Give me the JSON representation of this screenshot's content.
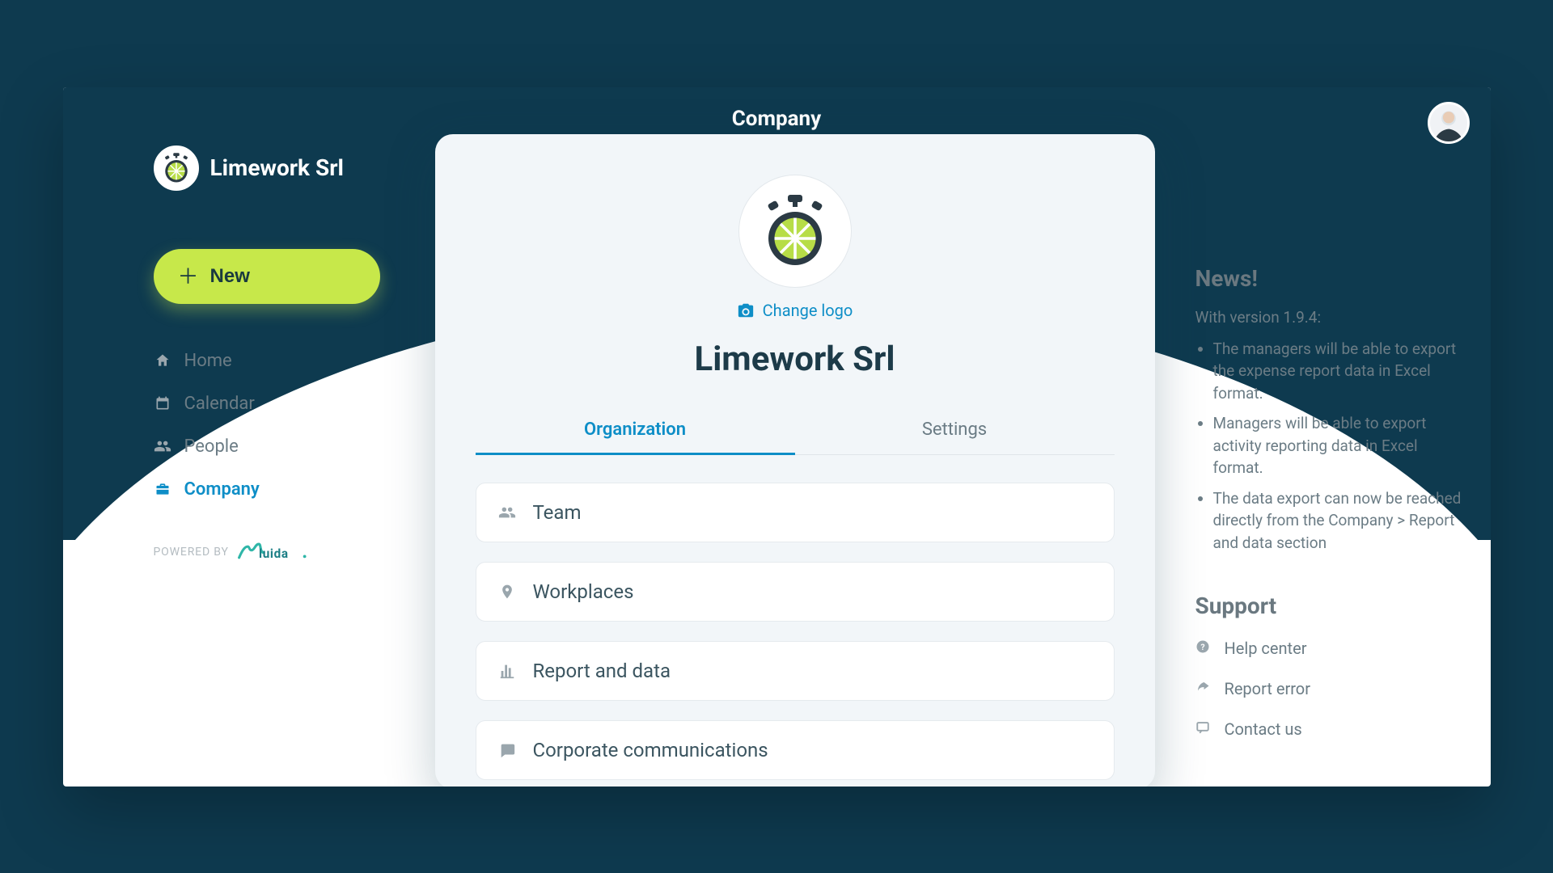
{
  "header": {
    "title": "Company"
  },
  "brand": {
    "name": "Limework Srl"
  },
  "sidebar": {
    "new_label": "New",
    "items": [
      {
        "icon": "home",
        "label": "Home",
        "active": false
      },
      {
        "icon": "calendar",
        "label": "Calendar",
        "active": false
      },
      {
        "icon": "people",
        "label": "People",
        "active": false
      },
      {
        "icon": "company",
        "label": "Company",
        "active": true
      }
    ],
    "powered_by": "POWERED BY",
    "powered_brand": "Fluida"
  },
  "main": {
    "change_logo": "Change logo",
    "company_name": "Limework Srl",
    "tabs": [
      {
        "label": "Organization",
        "active": true
      },
      {
        "label": "Settings",
        "active": false
      }
    ],
    "sections": [
      {
        "icon": "team",
        "label": "Team"
      },
      {
        "icon": "pin",
        "label": "Workplaces"
      },
      {
        "icon": "chart",
        "label": "Report and data"
      },
      {
        "icon": "chat",
        "label": "Corporate communications"
      }
    ]
  },
  "news": {
    "heading": "News!",
    "intro": "With version 1.9.4:",
    "items": [
      "The managers will be able to export the expense report data in Excel format.",
      "Managers will be able to export activity reporting data in Excel format.",
      "The data export can now be reached directly from the Company > Report and data section"
    ]
  },
  "support": {
    "heading": "Support",
    "links": [
      {
        "icon": "help",
        "label": "Help center"
      },
      {
        "icon": "report",
        "label": "Report error"
      },
      {
        "icon": "contact",
        "label": "Contact us"
      }
    ]
  }
}
